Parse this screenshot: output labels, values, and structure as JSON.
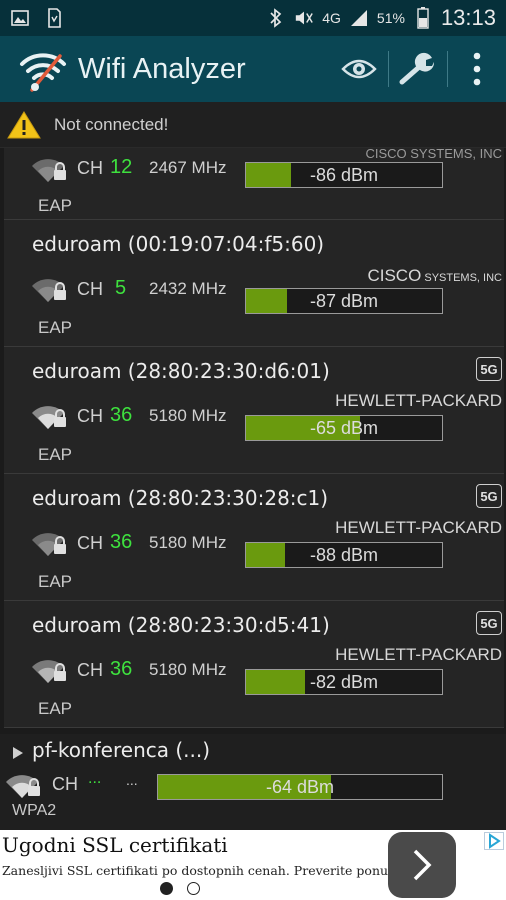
{
  "status_bar": {
    "network_type": "4G",
    "battery": "51%",
    "time": "13:13",
    "icons": [
      "image-icon",
      "sim-icon",
      "bluetooth-icon",
      "mute-icon",
      "signal-icon",
      "battery-icon"
    ]
  },
  "app_bar": {
    "title": "Wifi Analyzer",
    "actions": [
      "eye-icon",
      "wrench-icon",
      "overflow-menu-icon"
    ]
  },
  "warning": {
    "text": "Not connected!"
  },
  "networks": [
    {
      "ssid": "",
      "vendor": "CISCO SYSTEMS, INC",
      "badge": "",
      "channel_label": "CH",
      "channel": "12",
      "frequency": "2467 MHz",
      "signal": "-86 dBm",
      "signal_fraction": 0.23,
      "security": "EAP"
    },
    {
      "ssid": "eduroam (00:19:07:04:f5:60)",
      "vendor_main": "CISCO",
      "vendor_rest": " SYSTEMS, INC",
      "badge": "",
      "channel_label": "CH",
      "channel": "5",
      "frequency": "2432 MHz",
      "signal": "-87 dBm",
      "signal_fraction": 0.21,
      "security": "EAP"
    },
    {
      "ssid": "eduroam (28:80:23:30:d6:01)",
      "vendor": "HEWLETT-PACKARD",
      "badge": "5G",
      "channel_label": "CH",
      "channel": "36",
      "frequency": "5180 MHz",
      "signal": "-65 dBm",
      "signal_fraction": 0.58,
      "security": "EAP"
    },
    {
      "ssid": "eduroam (28:80:23:30:28:c1)",
      "vendor": "HEWLETT-PACKARD",
      "badge": "5G",
      "channel_label": "CH",
      "channel": "36",
      "frequency": "5180 MHz",
      "signal": "-88 dBm",
      "signal_fraction": 0.2,
      "security": "EAP"
    },
    {
      "ssid": "eduroam (28:80:23:30:d5:41)",
      "vendor": "HEWLETT-PACKARD",
      "badge": "5G",
      "channel_label": "CH",
      "channel": "36",
      "frequency": "5180 MHz",
      "signal": "-82 dBm",
      "signal_fraction": 0.3,
      "security": "EAP"
    }
  ],
  "group": {
    "name": "pf-konferenca (...)",
    "channel_label": "CH",
    "channel": "...",
    "frequency": "...",
    "signal": "-64 dBm",
    "signal_fraction": 0.61,
    "security": "WPA2"
  },
  "ad": {
    "title": "Ugodni SSL certifikati",
    "description": "Zanesljivi SSL certifikati po dostopnih cenah. Preverite ponudbo!",
    "pager": [
      true,
      false
    ]
  }
}
